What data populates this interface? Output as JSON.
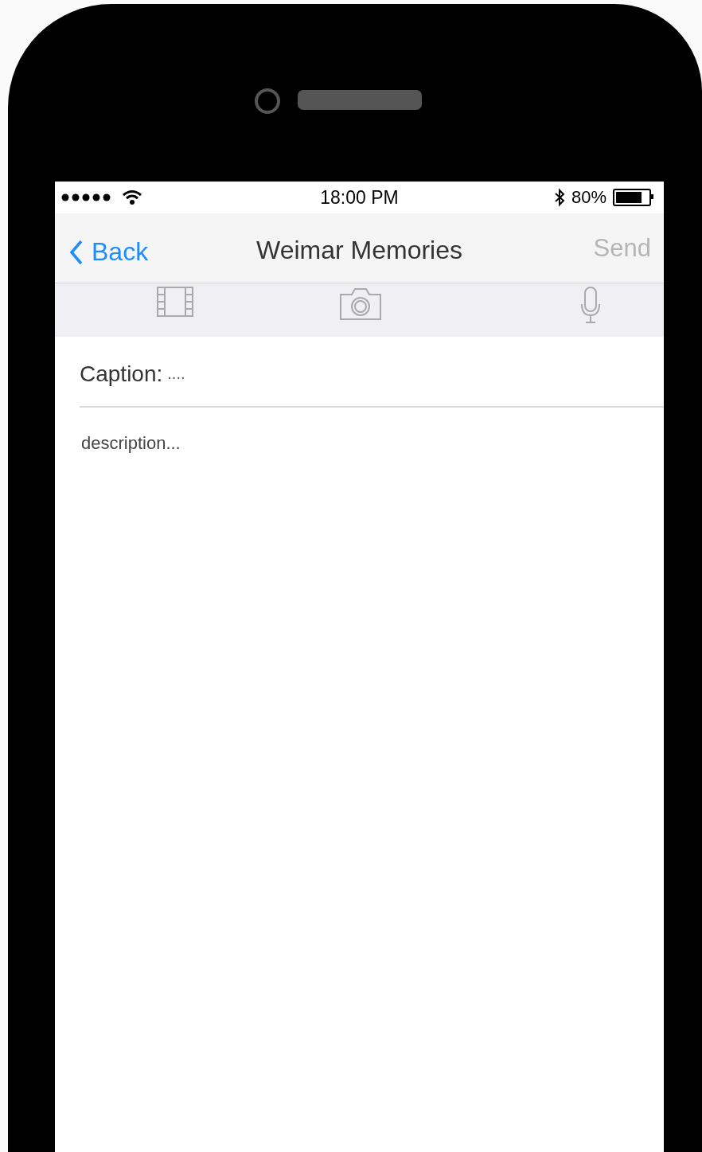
{
  "status_bar": {
    "time": "18:00 PM",
    "battery_text": "80%"
  },
  "nav_bar": {
    "back": "Back",
    "title": "Weimar Memories",
    "action": "Send",
    "action_disabled": true
  },
  "media_toolbar": [
    {
      "kind": "video"
    },
    {
      "kind": "camera"
    },
    {
      "kind": "microphone"
    }
  ],
  "caption": {
    "label": "Caption:",
    "placeholder": "...."
  },
  "description": {
    "placeholder": "description..."
  }
}
